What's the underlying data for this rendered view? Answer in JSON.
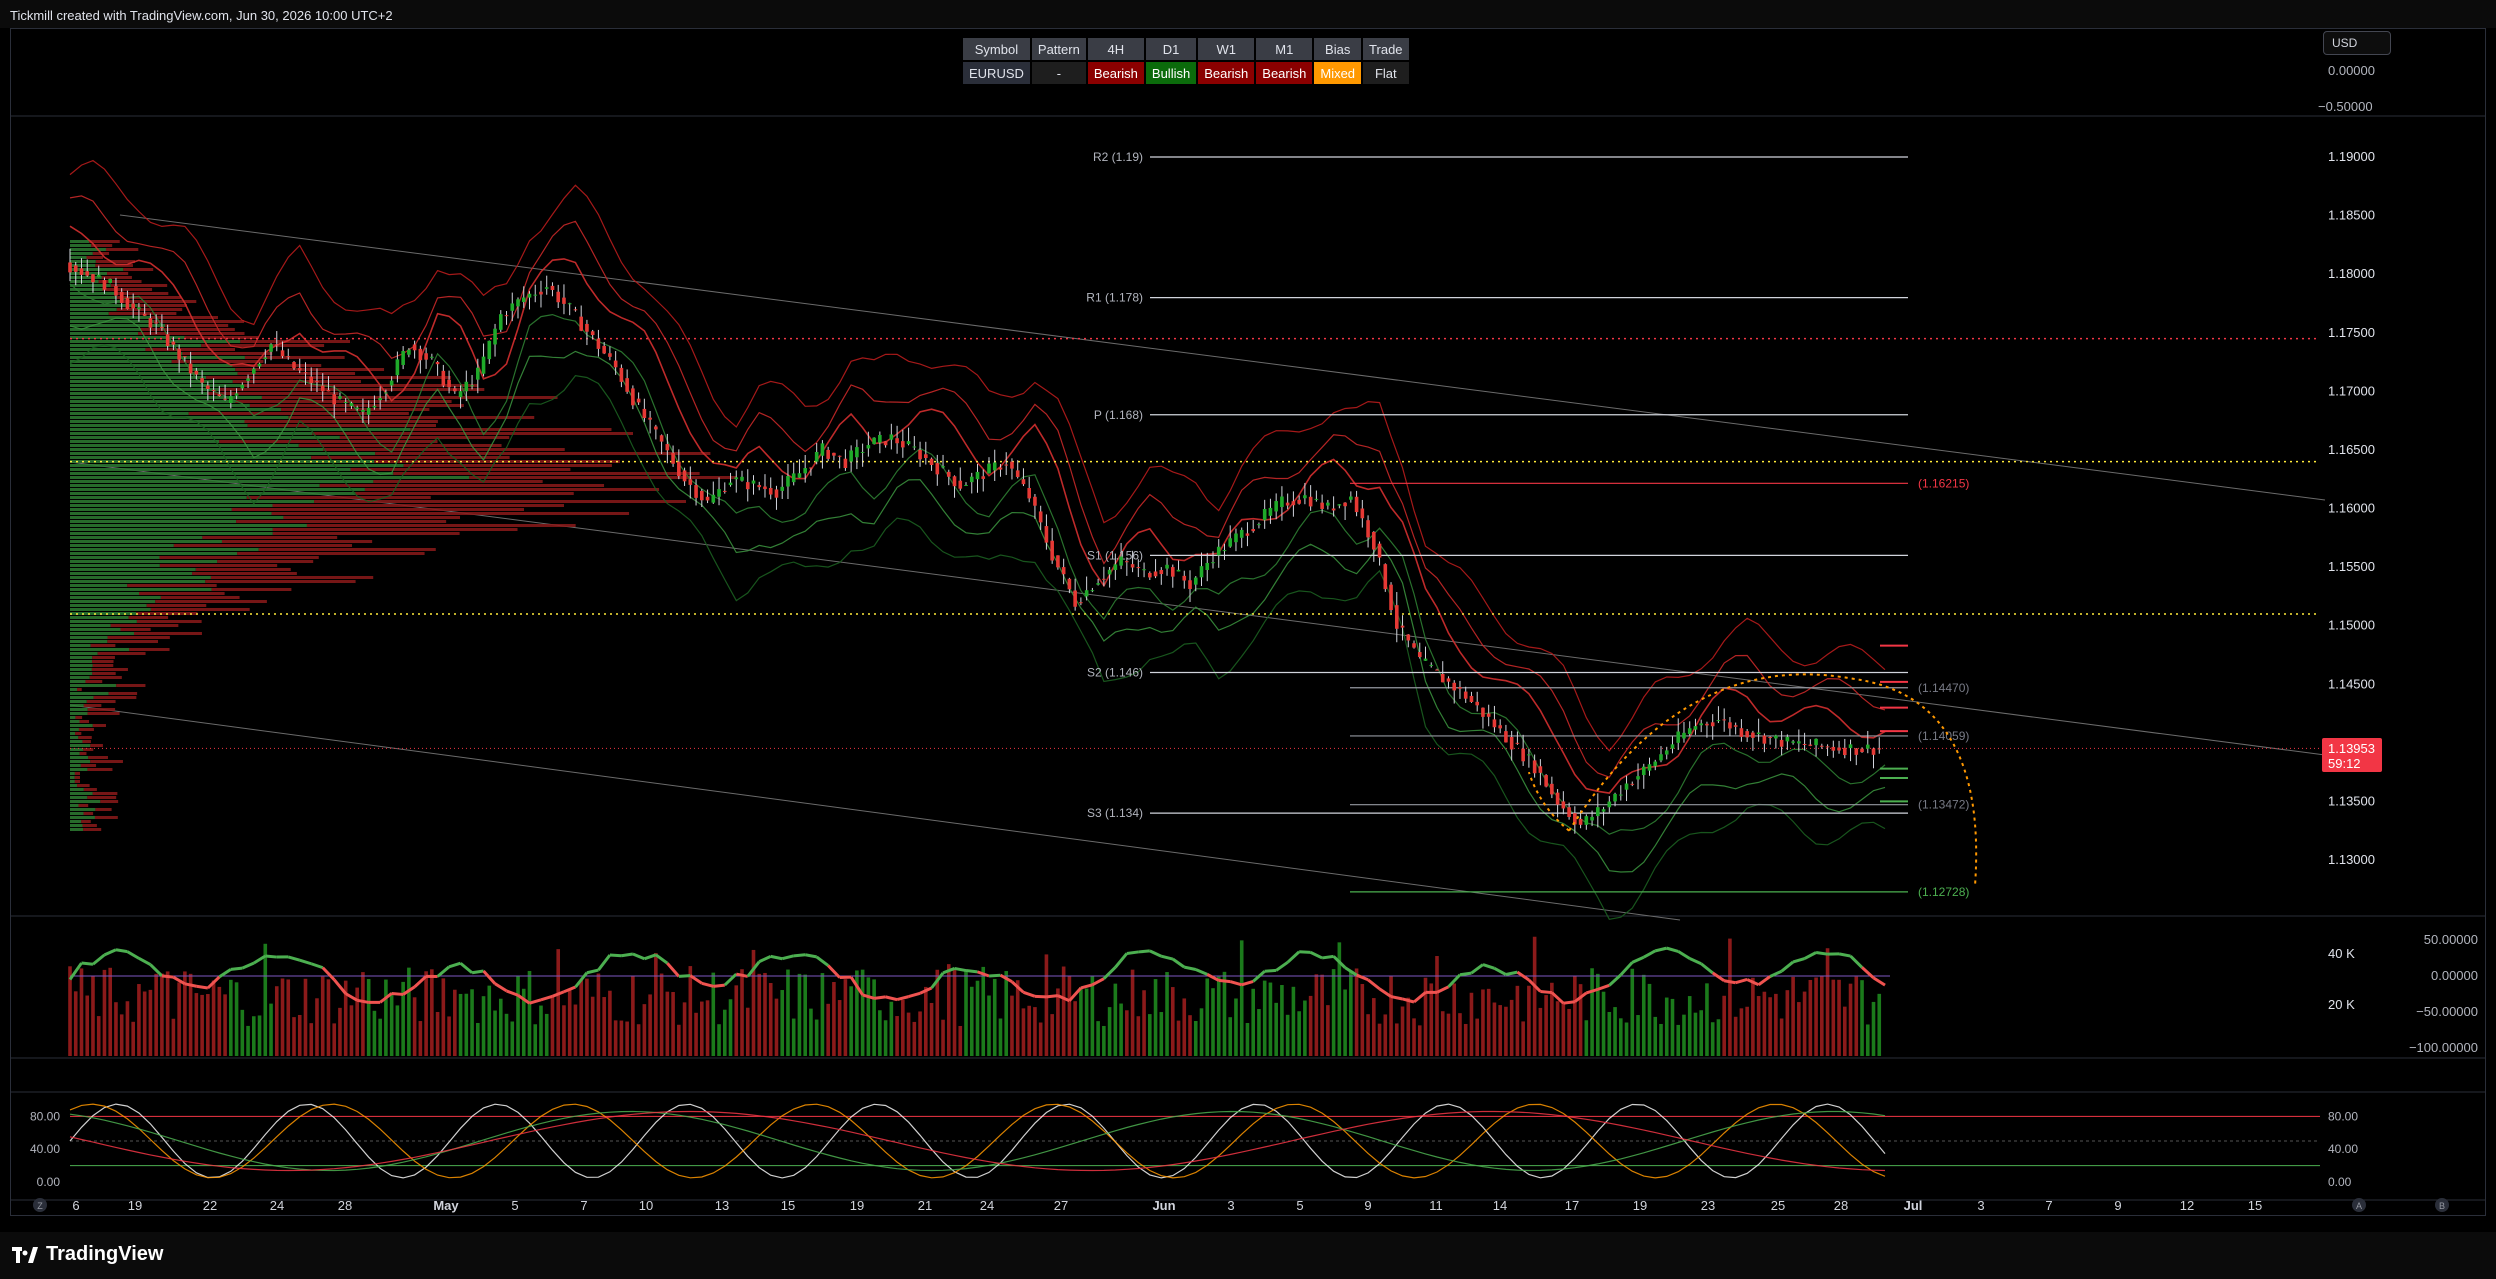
{
  "header": {
    "caption": "Tickmill created with TradingView.com, Jun 30, 2026 10:00 UTC+2"
  },
  "footer": {
    "brand": "TradingView"
  },
  "currency_button": "USD",
  "colors": {
    "bull": "#26a69a",
    "bear": "#f23645",
    "bull_bar": "#1b7a1b",
    "bear_bar": "#8b1a1a",
    "pivot": "#d1d4dc",
    "mixed": "#ff9800"
  },
  "bias_table": {
    "headers": [
      "Symbol",
      "Pattern",
      "4H",
      "D1",
      "W1",
      "M1",
      "Bias",
      "Trade"
    ],
    "values": [
      "EURUSD",
      "-",
      "Bearish",
      "Bullish",
      "Bearish",
      "Bearish",
      "Mixed",
      "Flat"
    ]
  },
  "price_tag": {
    "price": "1.13953",
    "countdown": "59:12"
  },
  "pivot_labels": [
    "R2 (1.19)",
    "R1 (1.178)",
    "P (1.168)",
    "S1 (1.156)",
    "S2 (1.146)",
    "S3 (1.134)"
  ],
  "level_labels": [
    "(1.16215)",
    "(1.14470)",
    "(1.14059)",
    "(1.13472)",
    "(1.12728)"
  ],
  "price_axis_labels": [
    "1.19000",
    "1.18500",
    "1.18000",
    "1.17500",
    "1.17000",
    "1.16500",
    "1.16000",
    "1.15500",
    "1.15000",
    "1.14500",
    "1.13500",
    "1.13000"
  ],
  "top_pane_axis_labels": [
    "0.00000",
    "−0.50000"
  ],
  "volume_axis_labels": [
    "40 K",
    "20 K"
  ],
  "oscillator_axis_labels": [
    "50.00000",
    "0.00000",
    "−50.00000",
    "−100.00000"
  ],
  "stoch_axis_labels": [
    "80.00",
    "40.00",
    "0.00"
  ],
  "time_axis_labels": [
    "6",
    "19",
    "22",
    "24",
    "28",
    "May",
    "5",
    "7",
    "10",
    "13",
    "15",
    "19",
    "21",
    "24",
    "27",
    "Jun",
    "3",
    "5",
    "9",
    "11",
    "14",
    "17",
    "19",
    "23",
    "25",
    "28",
    "Jul",
    "3",
    "7",
    "9",
    "12",
    "15"
  ],
  "corner_buttons": [
    "Z",
    "A",
    "B"
  ],
  "chart_data": {
    "type": "line",
    "title": "EURUSD",
    "ylim": [
      1.125,
      1.192
    ],
    "price_path": {
      "x_index": [
        0,
        4,
        8,
        12,
        16,
        20,
        24,
        28,
        32,
        36,
        40,
        44,
        48,
        52,
        56,
        60,
        64,
        68,
        72,
        76,
        80,
        84,
        88,
        92,
        96,
        100,
        104,
        108,
        112,
        116,
        120,
        124,
        128,
        132,
        136,
        140,
        144,
        148,
        152,
        156,
        160,
        164,
        168,
        172,
        176,
        180,
        184,
        188,
        192,
        196,
        200,
        204,
        208,
        212,
        216,
        220,
        224,
        228,
        232,
        236,
        240,
        244,
        248,
        252,
        256,
        260,
        264,
        268,
        272,
        276,
        280,
        284,
        288,
        292,
        296,
        300,
        304,
        308,
        312,
        316
      ],
      "close": [
        1.181,
        1.18,
        1.179,
        1.177,
        1.1755,
        1.173,
        1.1705,
        1.169,
        1.1715,
        1.174,
        1.172,
        1.1705,
        1.169,
        1.168,
        1.1705,
        1.174,
        1.1725,
        1.1695,
        1.1715,
        1.1765,
        1.178,
        1.179,
        1.177,
        1.1745,
        1.172,
        1.1685,
        1.1655,
        1.1625,
        1.1605,
        1.1625,
        1.162,
        1.1615,
        1.163,
        1.165,
        1.164,
        1.1655,
        1.166,
        1.165,
        1.1635,
        1.162,
        1.163,
        1.164,
        1.161,
        1.156,
        1.152,
        1.154,
        1.1555,
        1.1545,
        1.155,
        1.1535,
        1.156,
        1.1575,
        1.159,
        1.1605,
        1.161,
        1.16,
        1.161,
        1.157,
        1.15,
        1.147,
        1.1455,
        1.144,
        1.142,
        1.14,
        1.138,
        1.135,
        1.133,
        1.1345,
        1.1365,
        1.138,
        1.14,
        1.1415,
        1.142,
        1.141,
        1.1405,
        1.14,
        1.1398,
        1.1396,
        1.1395,
        1.13953
      ]
    },
    "pivot_levels": [
      1.19,
      1.178,
      1.168,
      1.156,
      1.146,
      1.134
    ],
    "key_levels": [
      1.16215,
      1.1447,
      1.14059,
      1.13472,
      1.12728
    ],
    "horizontal_dotted": [
      1.1745,
      1.164,
      1.151
    ],
    "last_price": 1.13953
  }
}
